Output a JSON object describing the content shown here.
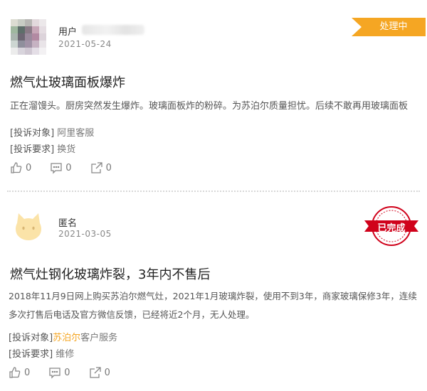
{
  "complaints": [
    {
      "user": "用户",
      "date": "2021-05-24",
      "status": "处理中",
      "title": "燃气灶玻璃面板爆炸",
      "content": "正在溜馒头。厨房突然发生爆炸。玻璃面板炸的粉碎。为苏泊尔质量担忧。后续不敢再用玻璃面板",
      "target_label": "[投诉对象]",
      "target_value": "阿里客服",
      "demand_label": "[投诉要求]",
      "demand_value": "换货",
      "likes": "0",
      "comments": "0",
      "shares": "0"
    },
    {
      "user": "匿名",
      "date": "2021-03-05",
      "status": "已完成",
      "title": "燃气灶钢化玻璃炸裂，3年内不售后",
      "content_line1": "2018年11月9日网上购买苏泊尔燃气灶，2021年1月玻璃炸裂，使用不到3年，商家玻璃保修3年，连续",
      "content_line2": "多次打售后电话及官方微信反馈，已经将近2个月，无人处理。",
      "target_label": "[投诉对象]",
      "target_link": "苏泊尔",
      "target_value": "客户服务",
      "demand_label": "[投诉要求]",
      "demand_value": "维修",
      "likes": "0",
      "comments": "0",
      "shares": "0"
    }
  ],
  "colors": {
    "status_orange": "#f5a623",
    "stamp_red": "#d0021b",
    "link_orange": "#f5a623"
  }
}
